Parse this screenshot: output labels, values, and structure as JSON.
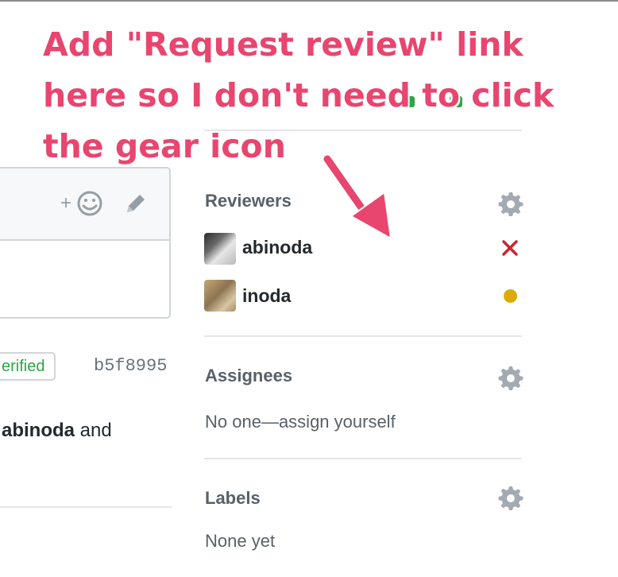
{
  "annotation": {
    "line1": "Add \"Request review\" link",
    "line2": "here so I don't need to click",
    "line3": "the gear icon"
  },
  "comment": {
    "add_reaction_label": "+",
    "edit_icon": "pencil-icon",
    "reaction_icon": "smiley-icon"
  },
  "commit": {
    "badge": "erified",
    "sha": "b5f8995"
  },
  "event": {
    "actor": "abinoda",
    "trailing": " and"
  },
  "sidebar": {
    "reviewers": {
      "title": "Reviewers",
      "items": [
        {
          "name": "abinoda",
          "status": "changes-requested",
          "status_icon": "x-icon",
          "status_color": "#cb2431"
        },
        {
          "name": "inoda",
          "status": "pending",
          "status_icon": "dot-icon",
          "status_color": "#dbab09"
        }
      ]
    },
    "assignees": {
      "title": "Assignees",
      "empty_text": "No one—assign yourself"
    },
    "labels": {
      "title": "Labels",
      "empty_text": "None yet"
    }
  },
  "colors": {
    "annotation": "#e8456f",
    "verified_green": "#28a745",
    "border": "#d1d5da",
    "muted_text": "#586069"
  }
}
